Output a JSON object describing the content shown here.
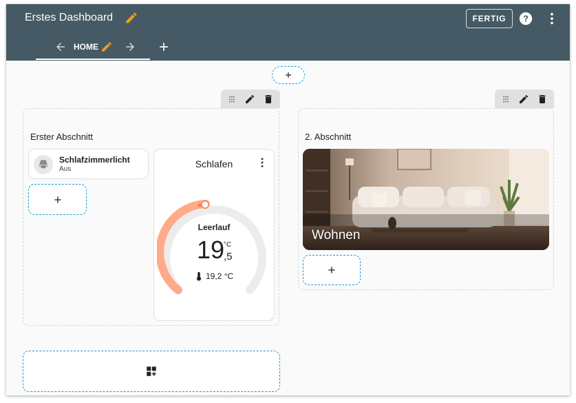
{
  "header": {
    "title": "Erstes Dashboard",
    "done_label": "FERTIG",
    "accent_color": "#f29b1d",
    "background_color": "#455a64"
  },
  "tabs": [
    {
      "label": "HOME",
      "active": true
    }
  ],
  "sections": [
    {
      "title": "Erster Abschnitt",
      "tools": [
        "drag-handle-icon",
        "pencil-icon",
        "trash-icon"
      ],
      "entity_card": {
        "name": "Schlafzimmerlicht",
        "state": "Aus",
        "icon": "ceiling-light-icon"
      },
      "thermostat": {
        "title": "Schlafen",
        "mode": "Leerlauf",
        "target_int": "19",
        "target_unit": "°C",
        "target_dec": ",5",
        "current": "19,2 °C",
        "accent_color": "#ff8c5a"
      }
    },
    {
      "title": "2. Abschnitt",
      "tools": [
        "drag-handle-icon",
        "pencil-icon",
        "trash-icon"
      ],
      "picture_card": {
        "label": "Wohnen"
      }
    }
  ],
  "add_section_icon": "add-card-icon",
  "dashed_color": "#1a9ad6"
}
